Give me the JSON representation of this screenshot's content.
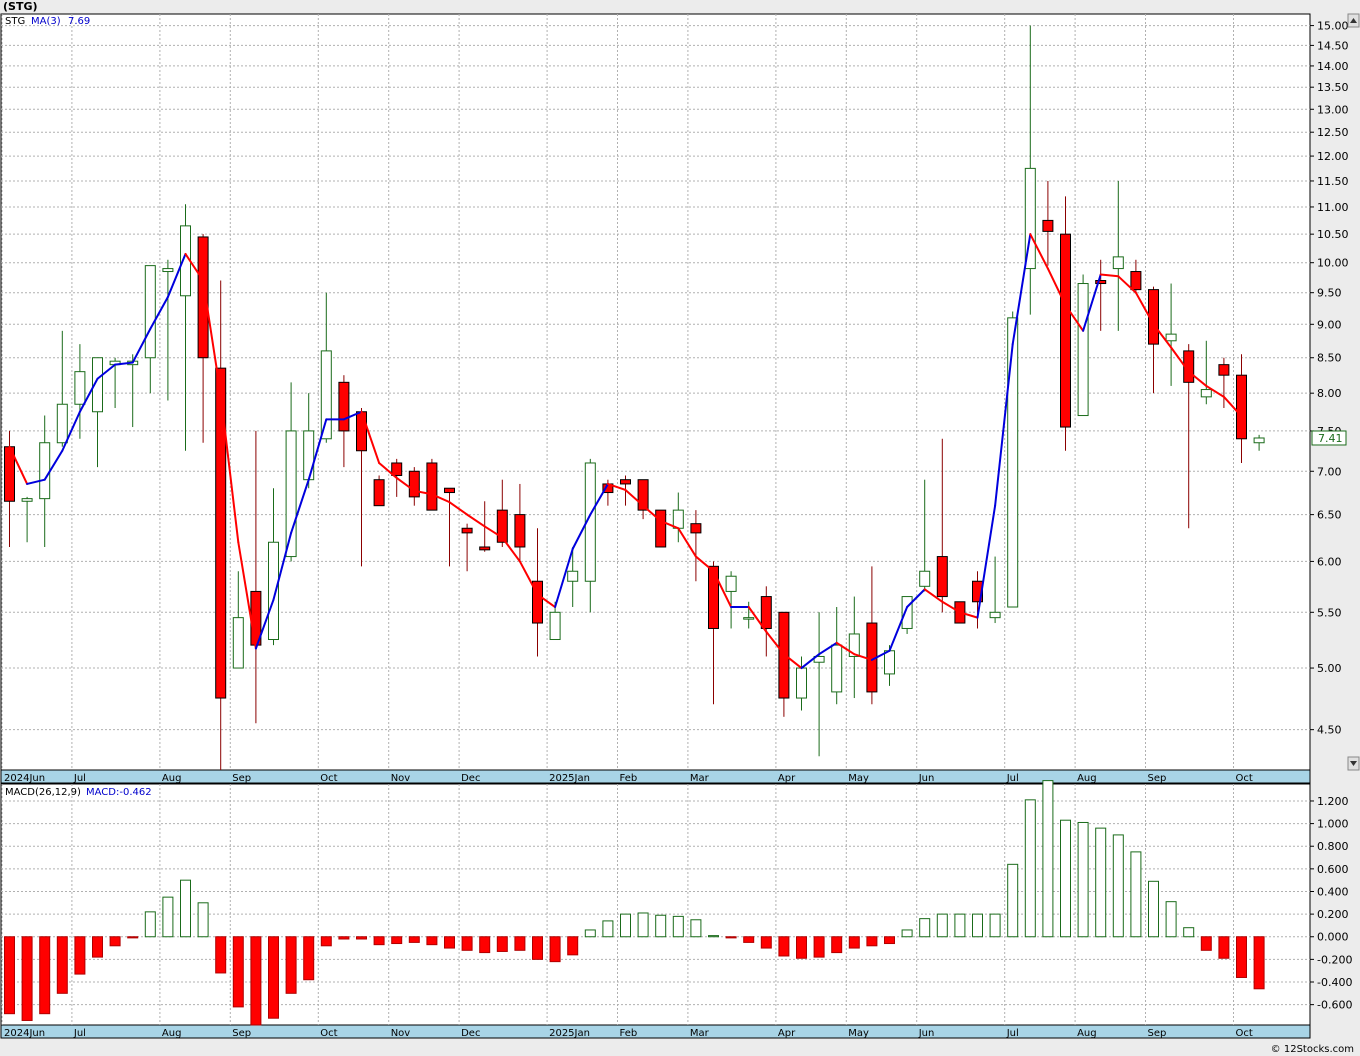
{
  "ticker": "(STG)",
  "watermark": "© 12Stocks.com",
  "colors": {
    "up": "#1a6b1a",
    "down": "#ff0000",
    "ma_up": "#0000dd",
    "ma_down": "#ff0000",
    "axis_bar": "#a8d4e6",
    "grid": "#b0b0b0"
  },
  "price_legend": {
    "symbol": "STG",
    "ma_label": "MA(3)",
    "ma_value": "7.69"
  },
  "macd_legend": {
    "label": "MACD(26,12,9)",
    "value_label": "MACD:-0.462"
  },
  "last_price": "7.41",
  "chart_data": [
    {
      "type": "candlestick",
      "title": "(STG)",
      "y_scale": "log",
      "ylim": [
        4.2,
        15.3
      ],
      "y_ticks": [
        "4.50",
        "5.00",
        "5.50",
        "6.00",
        "6.50",
        "7.00",
        "7.50",
        "8.00",
        "8.50",
        "9.00",
        "9.50",
        "10.00",
        "10.50",
        "11.00",
        "11.50",
        "12.00",
        "12.50",
        "13.00",
        "13.50",
        "14.00",
        "14.50",
        "15.00"
      ],
      "x_labels": [
        {
          "label": "2024Jun",
          "week": 0
        },
        {
          "label": "Jul",
          "week": 4
        },
        {
          "label": "Aug",
          "week": 9
        },
        {
          "label": "Sep",
          "week": 13
        },
        {
          "label": "Oct",
          "week": 18
        },
        {
          "label": "Nov",
          "week": 22
        },
        {
          "label": "Dec",
          "week": 26
        },
        {
          "label": "2025Jan",
          "week": 31
        },
        {
          "label": "Feb",
          "week": 35
        },
        {
          "label": "Mar",
          "week": 39
        },
        {
          "label": "Apr",
          "week": 44
        },
        {
          "label": "May",
          "week": 48
        },
        {
          "label": "Jun",
          "week": 52
        },
        {
          "label": "Jul",
          "week": 57
        },
        {
          "label": "Aug",
          "week": 61
        },
        {
          "label": "Sep",
          "week": 65
        },
        {
          "label": "Oct",
          "week": 70
        }
      ],
      "candles": [
        {
          "o": 7.3,
          "h": 7.5,
          "l": 6.15,
          "c": 6.65
        },
        {
          "o": 6.65,
          "h": 6.7,
          "l": 6.2,
          "c": 6.68
        },
        {
          "o": 6.68,
          "h": 7.7,
          "l": 6.15,
          "c": 7.35
        },
        {
          "o": 7.35,
          "h": 8.9,
          "l": 7.3,
          "c": 7.85
        },
        {
          "o": 7.85,
          "h": 8.7,
          "l": 7.4,
          "c": 8.3
        },
        {
          "o": 7.75,
          "h": 8.5,
          "l": 7.05,
          "c": 8.5
        },
        {
          "o": 8.4,
          "h": 8.5,
          "l": 7.8,
          "c": 8.45
        },
        {
          "o": 8.4,
          "h": 8.55,
          "l": 7.55,
          "c": 8.45
        },
        {
          "o": 8.5,
          "h": 9.95,
          "l": 8.0,
          "c": 9.95
        },
        {
          "o": 9.85,
          "h": 10.05,
          "l": 7.9,
          "c": 9.9
        },
        {
          "o": 9.45,
          "h": 11.05,
          "l": 7.25,
          "c": 10.65
        },
        {
          "o": 10.45,
          "h": 10.5,
          "l": 7.35,
          "c": 8.5
        },
        {
          "o": 8.35,
          "h": 9.7,
          "l": 4.2,
          "c": 4.75
        },
        {
          "o": 5.0,
          "h": 5.9,
          "l": 5.0,
          "c": 5.45
        },
        {
          "o": 5.7,
          "h": 7.5,
          "l": 4.55,
          "c": 5.2
        },
        {
          "o": 5.25,
          "h": 6.8,
          "l": 5.2,
          "c": 6.2
        },
        {
          "o": 6.05,
          "h": 8.15,
          "l": 6.0,
          "c": 7.5
        },
        {
          "o": 6.9,
          "h": 8.0,
          "l": 6.8,
          "c": 7.5
        },
        {
          "o": 7.4,
          "h": 9.5,
          "l": 7.35,
          "c": 8.6
        },
        {
          "o": 8.15,
          "h": 8.25,
          "l": 7.05,
          "c": 7.5
        },
        {
          "o": 7.75,
          "h": 7.8,
          "l": 5.95,
          "c": 7.25
        },
        {
          "o": 6.9,
          "h": 6.95,
          "l": 6.6,
          "c": 6.6
        },
        {
          "o": 7.1,
          "h": 7.15,
          "l": 6.7,
          "c": 6.95
        },
        {
          "o": 7.0,
          "h": 7.05,
          "l": 6.6,
          "c": 6.7
        },
        {
          "o": 7.1,
          "h": 7.15,
          "l": 6.55,
          "c": 6.55
        },
        {
          "o": 6.8,
          "h": 6.8,
          "l": 5.95,
          "c": 6.75
        },
        {
          "o": 6.35,
          "h": 6.4,
          "l": 5.9,
          "c": 6.3
        },
        {
          "o": 6.15,
          "h": 6.65,
          "l": 6.1,
          "c": 6.12
        },
        {
          "o": 6.55,
          "h": 6.9,
          "l": 6.15,
          "c": 6.2
        },
        {
          "o": 6.5,
          "h": 6.85,
          "l": 6.0,
          "c": 6.15
        },
        {
          "o": 5.8,
          "h": 6.35,
          "l": 5.1,
          "c": 5.4
        },
        {
          "o": 5.25,
          "h": 5.6,
          "l": 5.25,
          "c": 5.5
        },
        {
          "o": 5.8,
          "h": 6.15,
          "l": 5.55,
          "c": 5.9
        },
        {
          "o": 5.8,
          "h": 7.15,
          "l": 5.5,
          "c": 7.1
        },
        {
          "o": 6.85,
          "h": 6.9,
          "l": 6.6,
          "c": 6.75
        },
        {
          "o": 6.9,
          "h": 6.95,
          "l": 6.6,
          "c": 6.85
        },
        {
          "o": 6.9,
          "h": 6.9,
          "l": 6.45,
          "c": 6.55
        },
        {
          "o": 6.55,
          "h": 6.55,
          "l": 6.15,
          "c": 6.15
        },
        {
          "o": 6.35,
          "h": 6.75,
          "l": 6.2,
          "c": 6.55
        },
        {
          "o": 6.4,
          "h": 6.55,
          "l": 5.8,
          "c": 6.3
        },
        {
          "o": 5.95,
          "h": 6.0,
          "l": 4.7,
          "c": 5.35
        },
        {
          "o": 5.7,
          "h": 5.9,
          "l": 5.35,
          "c": 5.85
        },
        {
          "o": 5.45,
          "h": 5.6,
          "l": 5.35,
          "c": 5.45
        },
        {
          "o": 5.65,
          "h": 5.75,
          "l": 5.1,
          "c": 5.35
        },
        {
          "o": 5.5,
          "h": 5.5,
          "l": 4.6,
          "c": 4.75
        },
        {
          "o": 4.75,
          "h": 5.1,
          "l": 4.65,
          "c": 5.0
        },
        {
          "o": 5.05,
          "h": 5.5,
          "l": 4.3,
          "c": 5.1
        },
        {
          "o": 4.8,
          "h": 5.55,
          "l": 4.7,
          "c": 5.2
        },
        {
          "o": 5.1,
          "h": 5.65,
          "l": 4.75,
          "c": 5.3
        },
        {
          "o": 5.4,
          "h": 5.95,
          "l": 4.7,
          "c": 4.8
        },
        {
          "o": 4.95,
          "h": 5.2,
          "l": 4.85,
          "c": 5.15
        },
        {
          "o": 5.35,
          "h": 5.65,
          "l": 5.3,
          "c": 5.65
        },
        {
          "o": 5.75,
          "h": 6.9,
          "l": 5.7,
          "c": 5.9
        },
        {
          "o": 6.05,
          "h": 7.4,
          "l": 5.5,
          "c": 5.65
        },
        {
          "o": 5.6,
          "h": 5.6,
          "l": 5.4,
          "c": 5.4
        },
        {
          "o": 5.8,
          "h": 5.9,
          "l": 5.35,
          "c": 5.6
        },
        {
          "o": 5.45,
          "h": 6.05,
          "l": 5.4,
          "c": 5.5
        },
        {
          "o": 5.55,
          "h": 9.2,
          "l": 5.55,
          "c": 9.1
        },
        {
          "o": 9.9,
          "h": 15.0,
          "l": 9.15,
          "c": 11.75
        },
        {
          "o": 10.75,
          "h": 11.5,
          "l": 9.95,
          "c": 10.55
        },
        {
          "o": 10.5,
          "h": 11.2,
          "l": 7.25,
          "c": 7.55
        },
        {
          "o": 7.7,
          "h": 9.8,
          "l": 7.7,
          "c": 9.65
        },
        {
          "o": 9.7,
          "h": 10.05,
          "l": 8.9,
          "c": 9.65
        },
        {
          "o": 9.9,
          "h": 11.5,
          "l": 8.9,
          "c": 10.1
        },
        {
          "o": 9.85,
          "h": 10.05,
          "l": 9.5,
          "c": 9.55
        },
        {
          "o": 9.55,
          "h": 9.6,
          "l": 8.0,
          "c": 8.7
        },
        {
          "o": 8.75,
          "h": 9.65,
          "l": 8.1,
          "c": 8.85
        },
        {
          "o": 8.6,
          "h": 8.7,
          "l": 6.35,
          "c": 8.15
        },
        {
          "o": 7.95,
          "h": 8.75,
          "l": 7.85,
          "c": 8.05
        },
        {
          "o": 8.4,
          "h": 8.5,
          "l": 7.8,
          "c": 8.25
        },
        {
          "o": 8.25,
          "h": 8.55,
          "l": 7.1,
          "c": 7.4
        },
        {
          "o": 7.35,
          "h": 7.45,
          "l": 7.25,
          "c": 7.41
        }
      ],
      "ma3": [
        7.3,
        6.85,
        6.9,
        7.25,
        7.75,
        8.2,
        8.4,
        8.43,
        8.93,
        9.43,
        10.15,
        9.7,
        7.98,
        6.2,
        5.17,
        5.62,
        6.3,
        6.9,
        7.65,
        7.65,
        7.75,
        7.1,
        6.92,
        6.77,
        6.73,
        6.64,
        6.5,
        6.37,
        6.25,
        6.0,
        5.67,
        5.55,
        6.13,
        6.5,
        6.85,
        6.78,
        6.6,
        6.43,
        6.35,
        6.05,
        5.9,
        5.55,
        5.55,
        5.32,
        5.12,
        5.0,
        5.12,
        5.22,
        5.12,
        5.07,
        5.15,
        5.55,
        5.72,
        5.6,
        5.5,
        5.45,
        6.6,
        8.7,
        10.5,
        9.9,
        9.3,
        8.9,
        9.8,
        9.77,
        9.5,
        9.0,
        8.65,
        8.3,
        8.1,
        7.95,
        7.69
      ],
      "macd_ylim": [
        -0.78,
        1.35
      ],
      "macd_ticks": [
        "-0.600",
        "-0.400",
        "-0.200",
        "0.000",
        "0.200",
        "0.400",
        "0.600",
        "0.800",
        "1.000",
        "1.200"
      ],
      "macd_hist": [
        -0.68,
        -0.74,
        -0.68,
        -0.5,
        -0.33,
        -0.18,
        -0.08,
        -0.01,
        0.22,
        0.35,
        0.5,
        0.3,
        -0.32,
        -0.62,
        -0.78,
        -0.72,
        -0.5,
        -0.38,
        -0.08,
        -0.02,
        -0.02,
        -0.07,
        -0.06,
        -0.05,
        -0.07,
        -0.1,
        -0.12,
        -0.14,
        -0.13,
        -0.12,
        -0.2,
        -0.22,
        -0.16,
        0.06,
        0.14,
        0.2,
        0.21,
        0.19,
        0.18,
        0.15,
        0.01,
        -0.01,
        -0.05,
        -0.1,
        -0.17,
        -0.19,
        -0.18,
        -0.14,
        -0.1,
        -0.08,
        -0.06,
        0.06,
        0.16,
        0.2,
        0.2,
        0.2,
        0.2,
        0.64,
        1.21,
        1.38,
        1.03,
        1.01,
        0.96,
        0.9,
        0.75,
        0.49,
        0.31,
        0.08,
        -0.12,
        -0.19,
        -0.36,
        -0.46
      ]
    }
  ]
}
